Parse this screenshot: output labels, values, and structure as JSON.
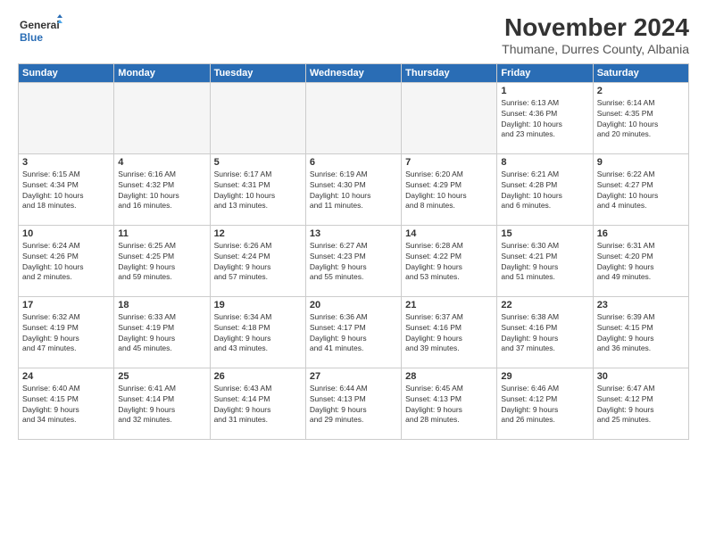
{
  "logo": {
    "line1": "General",
    "line2": "Blue"
  },
  "title": "November 2024",
  "subtitle": "Thumane, Durres County, Albania",
  "headers": [
    "Sunday",
    "Monday",
    "Tuesday",
    "Wednesday",
    "Thursday",
    "Friday",
    "Saturday"
  ],
  "weeks": [
    [
      {
        "day": "",
        "info": ""
      },
      {
        "day": "",
        "info": ""
      },
      {
        "day": "",
        "info": ""
      },
      {
        "day": "",
        "info": ""
      },
      {
        "day": "",
        "info": ""
      },
      {
        "day": "1",
        "info": "Sunrise: 6:13 AM\nSunset: 4:36 PM\nDaylight: 10 hours\nand 23 minutes."
      },
      {
        "day": "2",
        "info": "Sunrise: 6:14 AM\nSunset: 4:35 PM\nDaylight: 10 hours\nand 20 minutes."
      }
    ],
    [
      {
        "day": "3",
        "info": "Sunrise: 6:15 AM\nSunset: 4:34 PM\nDaylight: 10 hours\nand 18 minutes."
      },
      {
        "day": "4",
        "info": "Sunrise: 6:16 AM\nSunset: 4:32 PM\nDaylight: 10 hours\nand 16 minutes."
      },
      {
        "day": "5",
        "info": "Sunrise: 6:17 AM\nSunset: 4:31 PM\nDaylight: 10 hours\nand 13 minutes."
      },
      {
        "day": "6",
        "info": "Sunrise: 6:19 AM\nSunset: 4:30 PM\nDaylight: 10 hours\nand 11 minutes."
      },
      {
        "day": "7",
        "info": "Sunrise: 6:20 AM\nSunset: 4:29 PM\nDaylight: 10 hours\nand 8 minutes."
      },
      {
        "day": "8",
        "info": "Sunrise: 6:21 AM\nSunset: 4:28 PM\nDaylight: 10 hours\nand 6 minutes."
      },
      {
        "day": "9",
        "info": "Sunrise: 6:22 AM\nSunset: 4:27 PM\nDaylight: 10 hours\nand 4 minutes."
      }
    ],
    [
      {
        "day": "10",
        "info": "Sunrise: 6:24 AM\nSunset: 4:26 PM\nDaylight: 10 hours\nand 2 minutes."
      },
      {
        "day": "11",
        "info": "Sunrise: 6:25 AM\nSunset: 4:25 PM\nDaylight: 9 hours\nand 59 minutes."
      },
      {
        "day": "12",
        "info": "Sunrise: 6:26 AM\nSunset: 4:24 PM\nDaylight: 9 hours\nand 57 minutes."
      },
      {
        "day": "13",
        "info": "Sunrise: 6:27 AM\nSunset: 4:23 PM\nDaylight: 9 hours\nand 55 minutes."
      },
      {
        "day": "14",
        "info": "Sunrise: 6:28 AM\nSunset: 4:22 PM\nDaylight: 9 hours\nand 53 minutes."
      },
      {
        "day": "15",
        "info": "Sunrise: 6:30 AM\nSunset: 4:21 PM\nDaylight: 9 hours\nand 51 minutes."
      },
      {
        "day": "16",
        "info": "Sunrise: 6:31 AM\nSunset: 4:20 PM\nDaylight: 9 hours\nand 49 minutes."
      }
    ],
    [
      {
        "day": "17",
        "info": "Sunrise: 6:32 AM\nSunset: 4:19 PM\nDaylight: 9 hours\nand 47 minutes."
      },
      {
        "day": "18",
        "info": "Sunrise: 6:33 AM\nSunset: 4:19 PM\nDaylight: 9 hours\nand 45 minutes."
      },
      {
        "day": "19",
        "info": "Sunrise: 6:34 AM\nSunset: 4:18 PM\nDaylight: 9 hours\nand 43 minutes."
      },
      {
        "day": "20",
        "info": "Sunrise: 6:36 AM\nSunset: 4:17 PM\nDaylight: 9 hours\nand 41 minutes."
      },
      {
        "day": "21",
        "info": "Sunrise: 6:37 AM\nSunset: 4:16 PM\nDaylight: 9 hours\nand 39 minutes."
      },
      {
        "day": "22",
        "info": "Sunrise: 6:38 AM\nSunset: 4:16 PM\nDaylight: 9 hours\nand 37 minutes."
      },
      {
        "day": "23",
        "info": "Sunrise: 6:39 AM\nSunset: 4:15 PM\nDaylight: 9 hours\nand 36 minutes."
      }
    ],
    [
      {
        "day": "24",
        "info": "Sunrise: 6:40 AM\nSunset: 4:15 PM\nDaylight: 9 hours\nand 34 minutes."
      },
      {
        "day": "25",
        "info": "Sunrise: 6:41 AM\nSunset: 4:14 PM\nDaylight: 9 hours\nand 32 minutes."
      },
      {
        "day": "26",
        "info": "Sunrise: 6:43 AM\nSunset: 4:14 PM\nDaylight: 9 hours\nand 31 minutes."
      },
      {
        "day": "27",
        "info": "Sunrise: 6:44 AM\nSunset: 4:13 PM\nDaylight: 9 hours\nand 29 minutes."
      },
      {
        "day": "28",
        "info": "Sunrise: 6:45 AM\nSunset: 4:13 PM\nDaylight: 9 hours\nand 28 minutes."
      },
      {
        "day": "29",
        "info": "Sunrise: 6:46 AM\nSunset: 4:12 PM\nDaylight: 9 hours\nand 26 minutes."
      },
      {
        "day": "30",
        "info": "Sunrise: 6:47 AM\nSunset: 4:12 PM\nDaylight: 9 hours\nand 25 minutes."
      }
    ]
  ]
}
